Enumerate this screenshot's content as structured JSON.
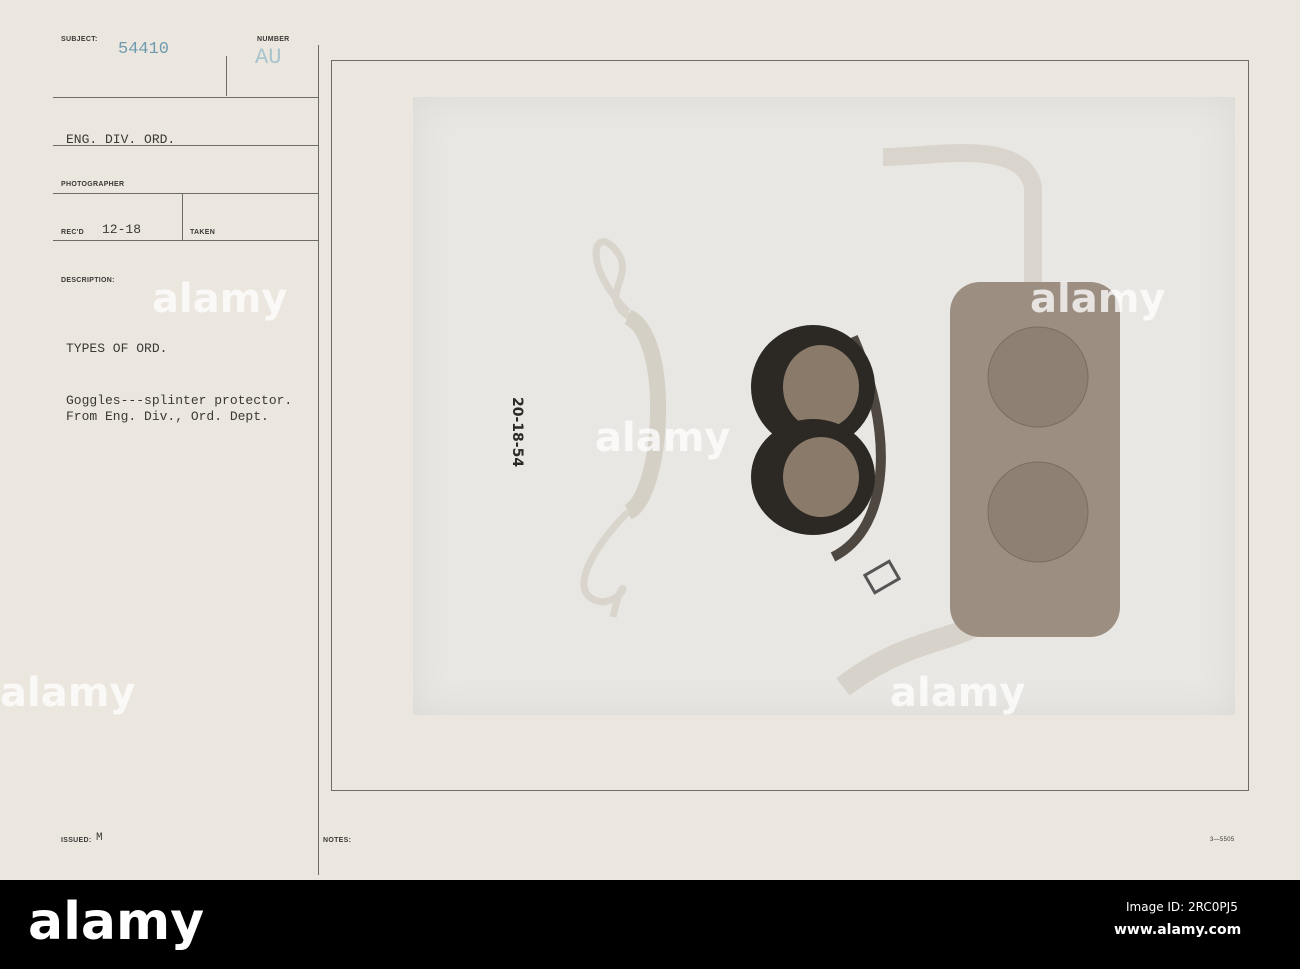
{
  "card": {
    "subject_label": "SUBJECT:",
    "subject_value": "54410",
    "number_label": "NUMBER",
    "number_value": "AU",
    "division": "ENG. DIV. ORD.",
    "photographer_label": "PHOTOGRAPHER",
    "recd_label": "REC'D",
    "recd_value": "12-18",
    "taken_label": "TAKEN",
    "description_label": "DESCRIPTION:",
    "description_title": "TYPES OF ORD.",
    "description_line1": "Goggles---splinter protector.",
    "description_line2": "From Eng. Div., Ord. Dept.",
    "issued_label": "ISSUED:",
    "issued_value": "M",
    "notes_label": "NOTES:",
    "form_number": "3—5505",
    "photo_inscription": "20-18-54"
  },
  "watermark": "alamy",
  "footer": {
    "logo": "alamy",
    "image_id": "Image ID: 2RC0PJ5",
    "url": "www.alamy.com"
  }
}
